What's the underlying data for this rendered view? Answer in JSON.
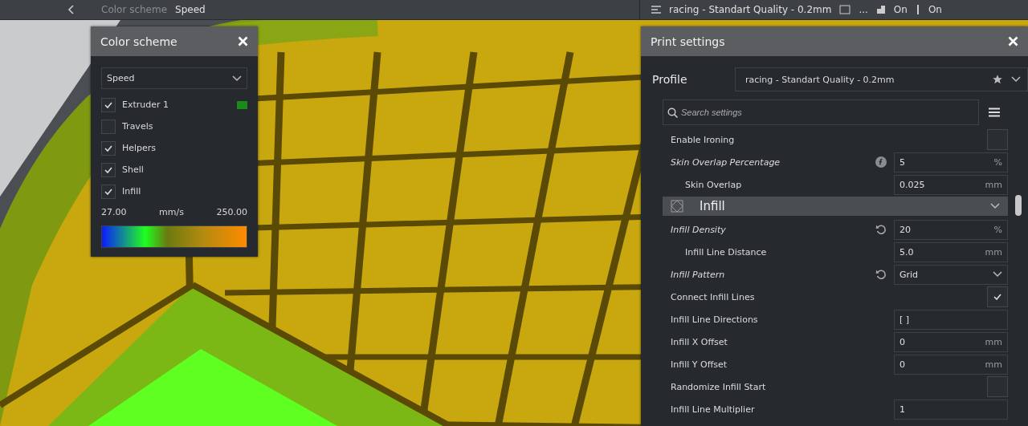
{
  "top_bar": {
    "view_label": "Color scheme",
    "view_value": "Speed",
    "profile": "racing - Standart Quality - 0.2mm",
    "more": "...",
    "adhesion": "On",
    "support": "On"
  },
  "color_scheme": {
    "title": "Color scheme",
    "scheme": "Speed",
    "items": [
      {
        "label": "Extruder 1",
        "checked": true,
        "color": "#1a8a1a"
      },
      {
        "label": "Travels",
        "checked": false
      },
      {
        "label": "Helpers",
        "checked": true
      },
      {
        "label": "Shell",
        "checked": true
      },
      {
        "label": "Infill",
        "checked": true
      }
    ],
    "min": "27.00",
    "unit": "mm/s",
    "max": "250.00"
  },
  "print_settings": {
    "title": "Print settings",
    "profile_label": "Profile",
    "profile": "racing - Standart Quality - 0.2mm",
    "search": {
      "placeholder": "Search settings"
    },
    "rows": [
      {
        "kind": "checkbox",
        "label": "Enable Ironing",
        "checked": false,
        "modified": false
      },
      {
        "kind": "number",
        "label": "Skin Overlap Percentage",
        "value": "5",
        "unit": "%",
        "modified": true,
        "formula": true,
        "children": [
          {
            "kind": "number",
            "label": "Skin Overlap",
            "value": "0.025",
            "unit": "mm",
            "modified": false
          }
        ]
      },
      {
        "kind": "category",
        "label": "Infill",
        "expanded": true
      },
      {
        "kind": "number",
        "label": "Infill Density",
        "value": "20",
        "unit": "%",
        "modified": true,
        "reset": true,
        "children": [
          {
            "kind": "number",
            "label": "Infill Line Distance",
            "value": "5.0",
            "unit": "mm",
            "modified": false
          }
        ]
      },
      {
        "kind": "dropdown",
        "label": "Infill Pattern",
        "value": "Grid",
        "modified": true,
        "reset": true
      },
      {
        "kind": "checkbox",
        "label": "Connect Infill Lines",
        "checked": true,
        "modified": false
      },
      {
        "kind": "text",
        "label": "Infill Line Directions",
        "value": "[ ]",
        "modified": false
      },
      {
        "kind": "number",
        "label": "Infill X Offset",
        "value": "0",
        "unit": "mm",
        "modified": false
      },
      {
        "kind": "number",
        "label": "Infill Y Offset",
        "value": "0",
        "unit": "mm",
        "modified": false
      },
      {
        "kind": "checkbox",
        "label": "Randomize Infill Start",
        "checked": false,
        "modified": false
      },
      {
        "kind": "number",
        "label": "Infill Line Multiplier",
        "value": "1",
        "modified": false
      }
    ]
  }
}
